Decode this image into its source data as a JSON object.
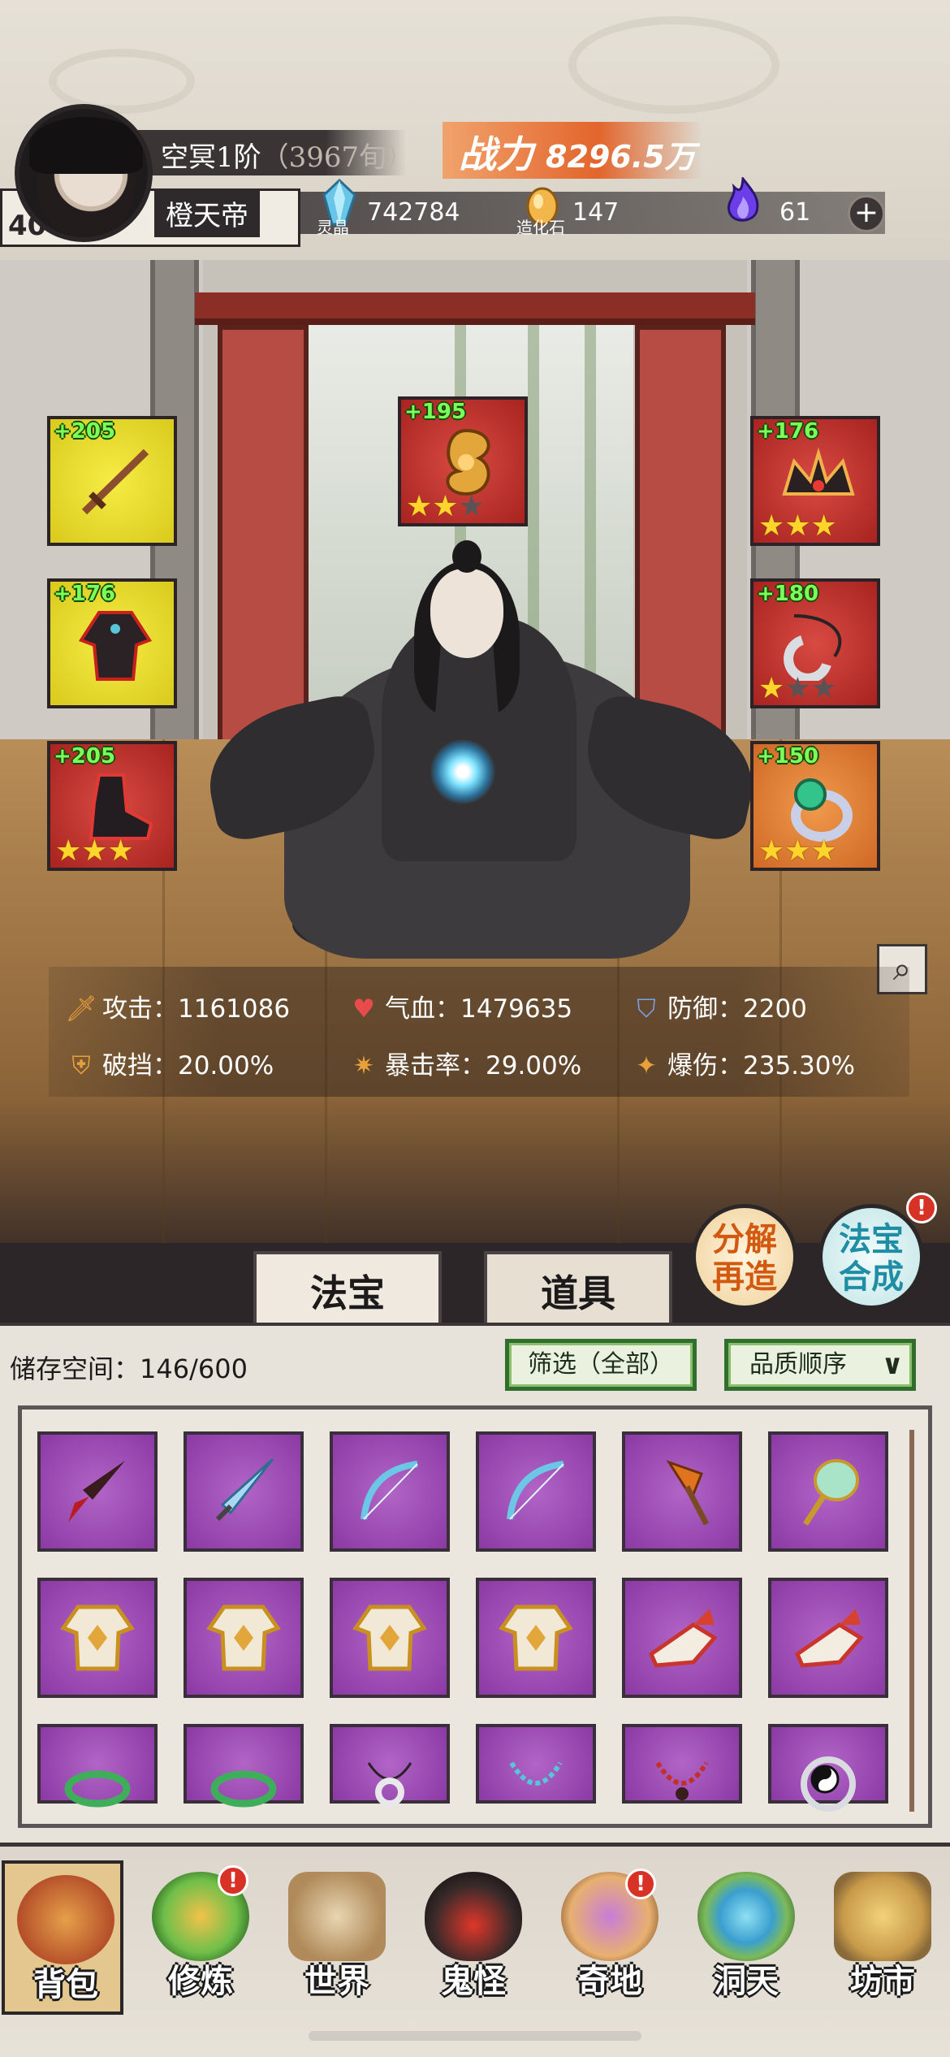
{
  "player": {
    "realm": "空冥1阶",
    "age": "（3967旬）",
    "name": "橙天帝",
    "stage": "40",
    "power_label": "战力",
    "power_value": "8296.5万"
  },
  "resources": [
    {
      "icon": "spirit-crystal-icon",
      "caption": "灵晶",
      "value": "742784"
    },
    {
      "icon": "creation-stone-icon",
      "caption": "造化石",
      "value": "147"
    },
    {
      "icon": "purple-flame-icon",
      "caption": "",
      "value": "61"
    }
  ],
  "plus_label": "+",
  "equipment": {
    "left": [
      {
        "level": "+205",
        "quality": "yellow",
        "stars": 0,
        "icon": "sword-icon"
      },
      {
        "level": "+176",
        "quality": "yellow",
        "stars": 0,
        "icon": "robe-icon"
      },
      {
        "level": "+205",
        "quality": "red",
        "stars": 3,
        "icon": "boots-icon"
      }
    ],
    "top": {
      "level": "+195",
      "quality": "red",
      "stars": 2,
      "icon": "dragon-talisman-icon"
    },
    "right": [
      {
        "level": "+176",
        "quality": "red",
        "stars": 3,
        "icon": "crown-icon"
      },
      {
        "level": "+180",
        "quality": "red",
        "stars": 1,
        "icon": "amulet-icon"
      },
      {
        "level": "+150",
        "quality": "orange",
        "stars": 3,
        "icon": "ring-icon"
      }
    ]
  },
  "stats": [
    {
      "icon": "attack-icon",
      "label": "攻击：",
      "value": "1161086"
    },
    {
      "icon": "health-icon",
      "label": "气血：",
      "value": "1479635"
    },
    {
      "icon": "defense-icon",
      "label": "防御：",
      "value": "2200"
    },
    {
      "icon": "block-break-icon",
      "label": "破挡：",
      "value": "20.00%"
    },
    {
      "icon": "crit-rate-icon",
      "label": "暴击率：",
      "value": "29.00%"
    },
    {
      "icon": "crit-damage-icon",
      "label": "爆伤：",
      "value": "235.30%"
    }
  ],
  "actions": {
    "decompose_line1": "分解",
    "decompose_line2": "再造",
    "synth_line1": "法宝",
    "synth_line2": "合成",
    "synth_badge": "!"
  },
  "tabs": [
    {
      "label": "法宝",
      "active": true
    },
    {
      "label": "道具",
      "active": false
    }
  ],
  "storage": {
    "label": "储存空间：",
    "used": "146/600",
    "filter": "筛选（全部）",
    "sort": "品质顺序"
  },
  "items": [
    "dagger-icon",
    "crystal-sword-icon",
    "ice-bow-icon",
    "ice-bow-icon",
    "axe-icon",
    "jade-mirror-icon",
    "gold-armor-icon",
    "gold-armor-icon",
    "gold-armor-icon",
    "gold-armor-icon",
    "winged-boots-icon",
    "winged-boots-icon",
    "leaf-wreath-icon",
    "leaf-wreath-icon",
    "pendant-icon",
    "bead-necklace-icon",
    "red-necklace-icon",
    "yinyang-ring-icon"
  ],
  "nav": [
    {
      "label": "背包",
      "icon": "backpack-icon",
      "active": true,
      "badge": ""
    },
    {
      "label": "修炼",
      "icon": "cultivate-icon",
      "active": false,
      "badge": "!"
    },
    {
      "label": "世界",
      "icon": "world-scroll-icon",
      "active": false,
      "badge": ""
    },
    {
      "label": "鬼怪",
      "icon": "demon-egg-icon",
      "active": false,
      "badge": ""
    },
    {
      "label": "奇地",
      "icon": "pagoda-icon",
      "active": false,
      "badge": "!"
    },
    {
      "label": "洞天",
      "icon": "portal-icon",
      "active": false,
      "badge": ""
    },
    {
      "label": "坊市",
      "icon": "market-icon",
      "active": false,
      "badge": ""
    }
  ],
  "colors": {
    "yellow_quality": "#e8dc2e",
    "red_quality": "#c0342e",
    "orange_quality": "#e07e37",
    "purple_item": "#9a47b2",
    "level_green": "#7dff5a",
    "power_orange": "#e2652c"
  }
}
